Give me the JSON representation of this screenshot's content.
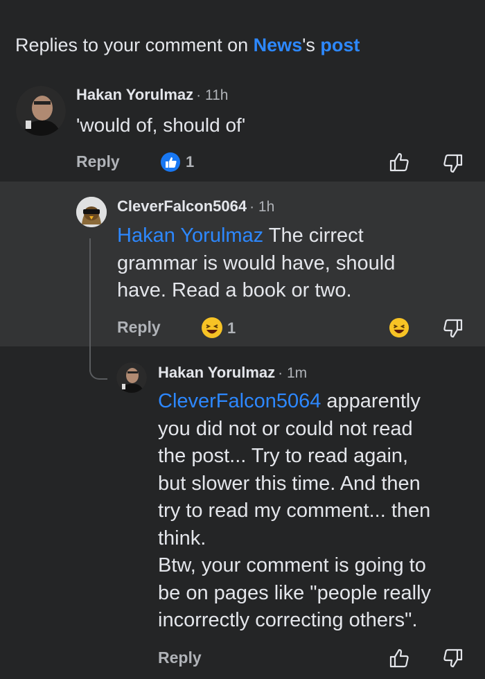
{
  "header": {
    "prefix": "Replies to your comment on ",
    "page_name": "News",
    "possessive": "'s ",
    "post_link": "post"
  },
  "comments": [
    {
      "author": "Hakan Yorulmaz",
      "time": "· 11h",
      "text": "'would of, should of'",
      "reply_label": "Reply",
      "reaction": "like",
      "reaction_count": "1"
    },
    {
      "author": "CleverFalcon5064",
      "time": "· 1h",
      "mention": "Hakan Yorulmaz",
      "text_lines": [
        "The cirrect",
        "grammar is would have, should",
        "have. Read a book or two."
      ],
      "reply_label": "Reply",
      "reaction": "haha",
      "reaction_count": "1"
    },
    {
      "author": "Hakan Yorulmaz",
      "time": "· 1m",
      "mention": "CleverFalcon5064",
      "text_lines": [
        "apparently",
        "you did not or could not read",
        "the post... Try to read again,",
        "but slower this time.  And then",
        "try to read my comment...  then",
        "think.",
        "Btw, your comment is going to",
        "be on pages like \"people really",
        "incorrectly correcting others\"."
      ],
      "reply_label": "Reply"
    }
  ],
  "icons": {
    "like": "thumbs-up-icon",
    "dislike": "thumbs-down-icon",
    "haha": "laughing-emoji-icon"
  },
  "colors": {
    "background": "#242526",
    "highlight": "#333435",
    "link": "#2d88ff",
    "text": "#e4e6eb",
    "muted": "#b0b3b8"
  }
}
